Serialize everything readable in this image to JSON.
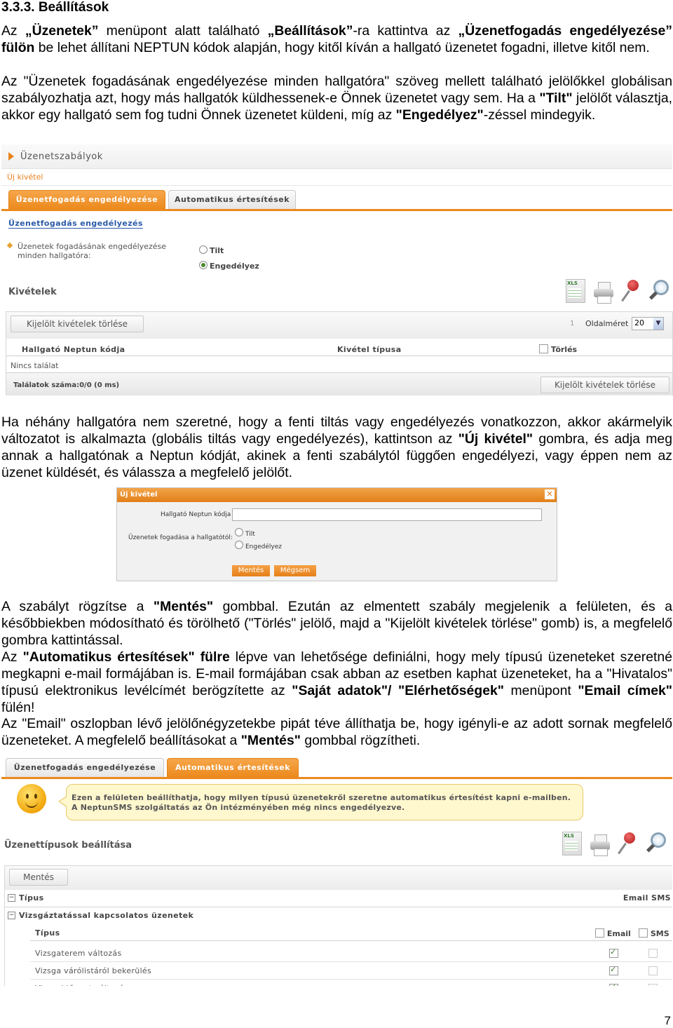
{
  "section_heading": "3.3.3. Beállítások",
  "paragraphs": {
    "p1": {
      "t1": "Az ",
      "b1": "„Üzenetek”",
      "t2": " menüpont alatt található ",
      "b2": "„Beállítások”",
      "t3": "-ra kattintva az ",
      "b3": "„Üzenetfogadás engedélyezése” fülön",
      "t4": " be lehet állítani NEPTUN kódok alapján, hogy kitől kíván a hallgató üzenetet fogadni, illetve kitől nem."
    },
    "p2": {
      "t1": "Az \"Üzenetek fogadásának engedélyezése minden hallgatóra\" szöveg mellett található jelölőkkel globálisan szabályozhatja azt, hogy más hallgatók küldhessenek-e Önnek üzenetet vagy sem. Ha a ",
      "b1": "\"Tilt\"",
      "t2": " jelölőt választja, akkor egy hallgató sem fog tudni Önnek üzenetet küldeni, míg az ",
      "b2": "\"Engedélyez\"",
      "t3": "-zéssel mindegyik."
    },
    "p3": {
      "t1": "Ha néhány hallgatóra nem szeretné, hogy a fenti tiltás vagy engedélyezés vonatkozzon, akkor akármelyik változatot is alkalmazta (globális tiltás vagy engedélyezés), kattintson az ",
      "b1": "\"Új kivétel\"",
      "t2": " gombra, és adja meg annak a hallgatónak a Neptun kódját, akinek a fenti szabálytól függően engedélyezi, vagy éppen nem az üzenet küldését, és válassza a megfelelő jelölőt."
    },
    "p4": {
      "t1": "A szabályt rögzítse a ",
      "b1": "\"Mentés\"",
      "t2": " gombbal. Ezután az elmentett szabály megjelenik a felületen, és a későbbiekben módosítható és törölhető (\"Törlés\" jelölő, majd a \"Kijelölt kivételek törlése\" gomb) is, a megfelelő gombra kattintással."
    },
    "p5": {
      "t1": "Az ",
      "b1": "\"Automatikus értesítések\" fülre",
      "t2": " lépve van lehetősége definiálni, hogy mely típusú üzeneteket szeretné megkapni e-mail formájában is. E-mail formájában csak abban az esetben kaphat üzeneteket, ha a \"Hivatalos\" típusú elektronikus levélcímét berögzítette az ",
      "b2": "\"Saját adatok\"/ \"Elérhetőségek\"",
      "t3": " menüpont ",
      "b3": "\"Email címek\"",
      "t4": " fülén!"
    },
    "p6": {
      "t1": "Az \"Email\" oszlopban lévő jelölőnégyzetekbe pipát téve állíthatja be, hogy igényli-e az adott sornak megfelelő üzeneteket. A megfelelő beállításokat a ",
      "b1": "\"Mentés\"",
      "t2": " gombbal rögzítheti."
    }
  },
  "shot1": {
    "title": "Üzenetszabályok",
    "new_exception_link": "Új kivétel",
    "tab_active": "Üzenetfogadás engedélyezése",
    "tab_inactive": "Automatikus értesítések",
    "section_title": "Üzenetfogadás engedélyezés",
    "global_label": "Üzenetek fogadásának engedélyezése minden hallgatóra:",
    "radio_tilt": "Tilt",
    "radio_enable": "Engedélyez",
    "radio_selected": "Engedélyez",
    "exceptions_title": "Kivételek",
    "delete_selected_top": "Kijelölt kivételek törlése",
    "page_num": "1",
    "page_size_label": "Oldalméret",
    "page_size_value": "20",
    "col_neptun": "Hallgató Neptun kódja",
    "col_type": "Kivétel típusa",
    "col_delete": "Törlés",
    "no_result": "Nincs találat",
    "result_count": "Találatok száma:0/0 (0 ms)",
    "delete_selected_bottom": "Kijelölt kivételek törlése",
    "xls_label": "XLS"
  },
  "shot2": {
    "title": "Új kivétel",
    "neptun_label": "Hallgató Neptun kódja",
    "receive_label": "Üzenetek fogadása a hallgatótól:",
    "radio_tilt": "Tilt",
    "radio_enable": "Engedélyez",
    "save_btn": "Mentés",
    "cancel_btn": "Mégsem",
    "close_icon_glyph": "✕"
  },
  "shot3": {
    "tab_inactive": "Üzenetfogadás engedélyezése",
    "tab_active": "Automatikus értesítések",
    "info_line1": "Ezen a felületen beállíthatja, hogy milyen típusú üzenetekről szeretne automatikus értesítést kapni e-mailben.",
    "info_line2": "A NeptunSMS szolgáltatás az Ön intézményében még nincs engedélyezve.",
    "section_title": "Üzenettípusok beállítása",
    "save_btn": "Mentés",
    "group_header": "Típus",
    "group_header_right": "Email SMS",
    "group1": "Vizsgáztatással kapcsolatos üzenetek",
    "sub_header": "Típus",
    "col_email": "Email",
    "col_sms": "SMS",
    "rows": [
      {
        "label": "Vizsgaterem változás",
        "email": true,
        "sms": false
      },
      {
        "label": "Vizsga várólistáról bekerülés",
        "email": true,
        "sms": false
      },
      {
        "label": "Vizsgaidőpont változás",
        "email": true,
        "sms": false
      }
    ],
    "xls_label": "XLS"
  },
  "page_number": "7",
  "colors": {
    "accent_orange": "#ec8a1e",
    "link_blue": "#2a5aa8",
    "check_green": "#3a7a2a"
  }
}
